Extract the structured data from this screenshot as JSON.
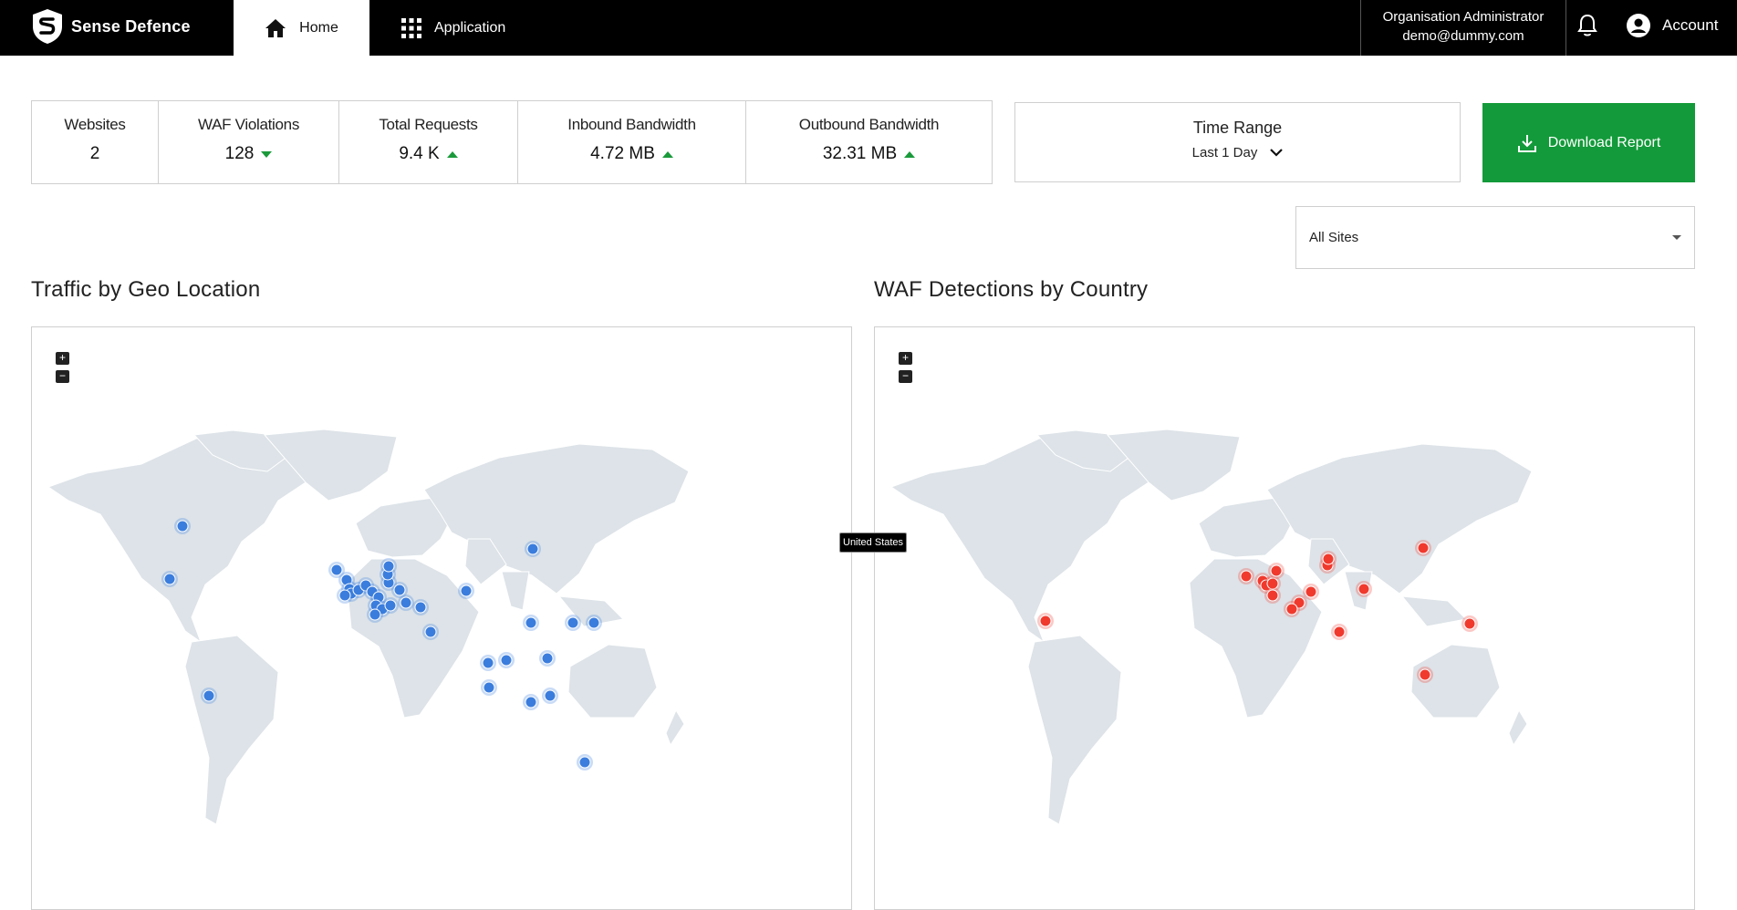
{
  "nav": {
    "brand": "Sense Defence",
    "tabs": [
      {
        "label": "Home",
        "icon": "home-icon"
      },
      {
        "label": "Application",
        "icon": "grid-icon"
      }
    ],
    "user_role": "Organisation Administrator",
    "user_email": "demo@dummy.com",
    "account_label": "Account"
  },
  "stats": [
    {
      "label": "Websites",
      "value": "2",
      "trend": "none"
    },
    {
      "label": "WAF Violations",
      "value": "128",
      "trend": "down"
    },
    {
      "label": "Total Requests",
      "value": "9.4 K",
      "trend": "up"
    },
    {
      "label": "Inbound Bandwidth",
      "value": "4.72 MB",
      "trend": "up"
    },
    {
      "label": "Outbound Bandwidth",
      "value": "32.31 MB",
      "trend": "up"
    }
  ],
  "time_range": {
    "title": "Time Range",
    "selected": "Last 1 Day"
  },
  "download_label": "Download Report",
  "site_filter": {
    "selected": "All Sites"
  },
  "traffic_map": {
    "title": "Traffic by Geo Location",
    "marker_color": "#3b7ddd",
    "zoom_in": "+",
    "zoom_out": "−"
  },
  "waf_map": {
    "title": "WAF Detections by Country",
    "marker_color": "#f03a2e",
    "zoom_in": "+",
    "zoom_out": "−"
  },
  "tooltip": "United States",
  "colors": {
    "accent_green": "#139a3a",
    "nav_bg": "#000000",
    "land": "#dde3e8"
  }
}
